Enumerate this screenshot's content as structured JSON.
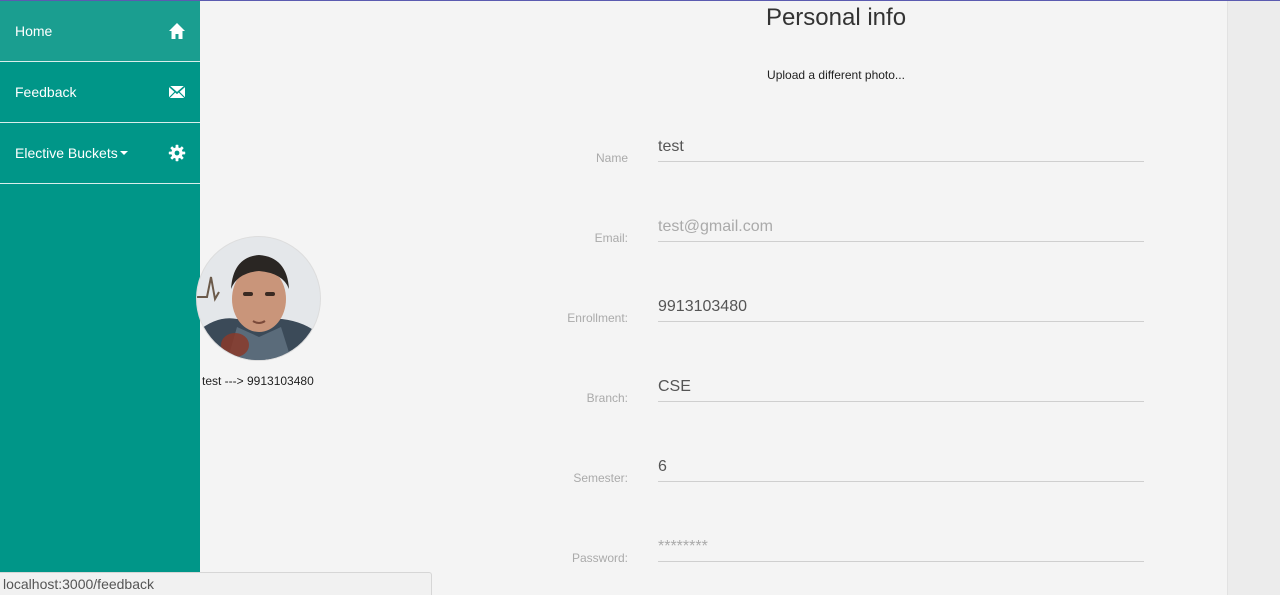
{
  "sidebar": {
    "items": [
      {
        "label": "Home",
        "icon": "home-icon"
      },
      {
        "label": "Feedback",
        "icon": "envelope-icon"
      },
      {
        "label": "Elective Buckets",
        "icon": "gear-icon"
      }
    ]
  },
  "main": {
    "title": "Personal info",
    "upload_link": "Upload a different photo...",
    "avatar_caption": "test ---> 9913103480",
    "fields": [
      {
        "label": "Name",
        "value": "test"
      },
      {
        "label": "Email:",
        "value": "test@gmail.com"
      },
      {
        "label": "Enrollment:",
        "value": "9913103480"
      },
      {
        "label": "Branch:",
        "value": "CSE"
      },
      {
        "label": "Semester:",
        "value": "6"
      },
      {
        "label": "Password:",
        "value": "********"
      }
    ]
  },
  "status_bar": {
    "url": "localhost:3000/feedback"
  },
  "colors": {
    "sidebar": "#009688",
    "sidebar_active": "#1a9e90",
    "background": "#f4f4f4"
  }
}
